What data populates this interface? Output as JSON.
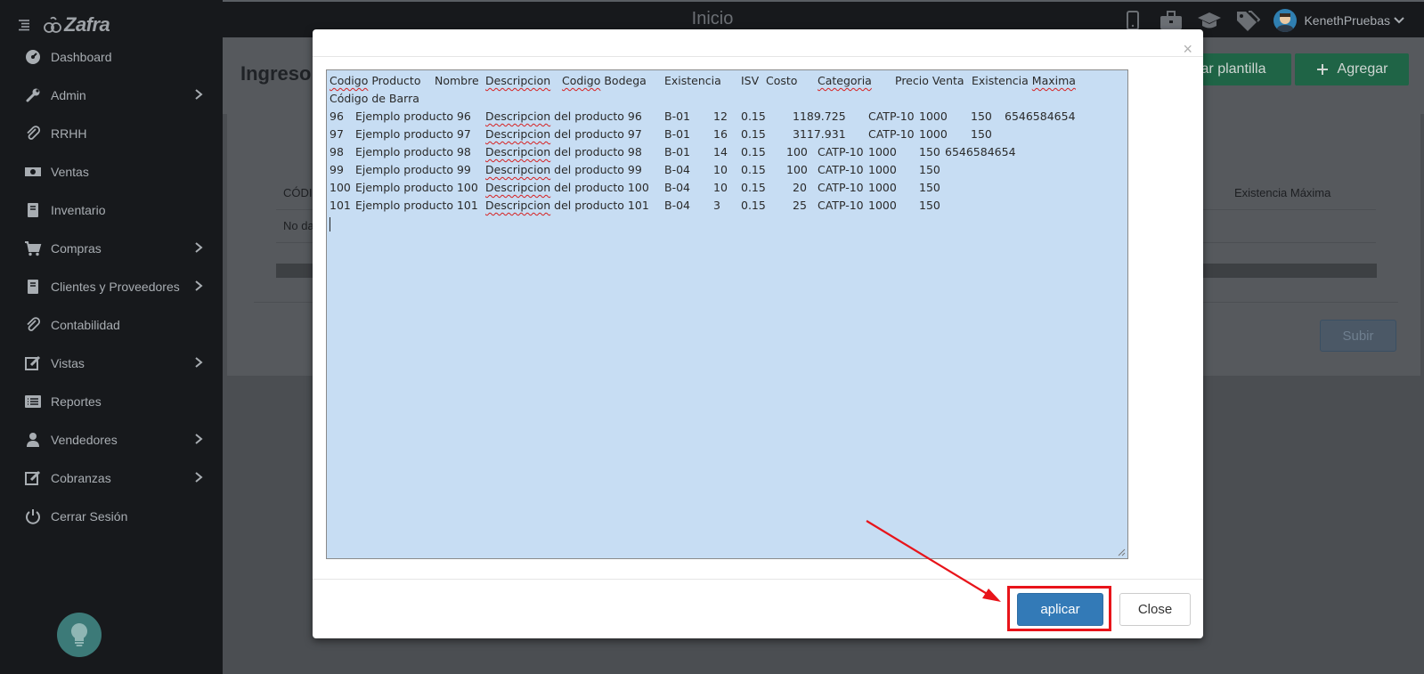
{
  "app": {
    "brand": "Zafra",
    "page_title": "Inicio"
  },
  "sidebar": {
    "items": [
      {
        "label": "Dashboard",
        "icon": "dashboard-icon",
        "submenu": false
      },
      {
        "label": "Admin",
        "icon": "wrench-icon",
        "submenu": true
      },
      {
        "label": "RRHH",
        "icon": "paperclip-icon",
        "submenu": false
      },
      {
        "label": "Ventas",
        "icon": "money-icon",
        "submenu": false
      },
      {
        "label": "Inventario",
        "icon": "book-icon",
        "submenu": false
      },
      {
        "label": "Compras",
        "icon": "cart-icon",
        "submenu": true
      },
      {
        "label": "Clientes y Proveedores",
        "icon": "book-icon",
        "submenu": true
      },
      {
        "label": "Contabilidad",
        "icon": "paperclip-icon",
        "submenu": false
      },
      {
        "label": "Vistas",
        "icon": "edit-icon",
        "submenu": true
      },
      {
        "label": "Reportes",
        "icon": "list-icon",
        "submenu": false
      },
      {
        "label": "Vendedores",
        "icon": "user-icon",
        "submenu": true
      },
      {
        "label": "Cobranzas",
        "icon": "edit-icon",
        "submenu": true
      },
      {
        "label": "Cerrar Sesión",
        "icon": "power-icon",
        "submenu": false
      }
    ]
  },
  "topbar": {
    "icons": [
      "mobile-icon",
      "briefcase-icon",
      "graduation-cap-icon",
      "tags-icon"
    ],
    "user_name": "KenethPruebas"
  },
  "background_page": {
    "title": "Ingreso",
    "buttons": {
      "template": "ar plantilla",
      "add": "Agregar",
      "upload": "Subir"
    },
    "table": {
      "header_first": "CÓDI",
      "header_last": "Existencia Máxima",
      "empty_text": "No da"
    }
  },
  "modal": {
    "close_symbol": "×",
    "textarea": {
      "header_row": [
        "Codigo Producto",
        "Nombre",
        "Descripcion",
        "Codigo Bodega",
        "Existencia",
        "ISV",
        "Costo",
        "Categoria",
        "Precio Venta",
        "Existencia Maxima"
      ],
      "header_row2": "Código de Barra",
      "rows": [
        [
          "96",
          "Ejemplo producto 96",
          "Descripcion del producto 96",
          "B-01",
          "12",
          "0.15",
          "1189.725",
          "CATP-10",
          "1000",
          "150",
          "6546584654"
        ],
        [
          "97",
          "Ejemplo producto 97",
          "Descripcion del producto 97",
          "B-01",
          "16",
          "0.15",
          "3117.931",
          "CATP-10",
          "1000",
          "150",
          ""
        ],
        [
          "98",
          "Ejemplo producto 98",
          "Descripcion del producto 98",
          "B-01",
          "14",
          "0.15",
          "100",
          "CATP-10",
          "1000",
          "150",
          "6546584654"
        ],
        [
          "99",
          "Ejemplo producto 99",
          "Descripcion del producto 99",
          "B-04",
          "10",
          "0.15",
          "100",
          "CATP-10",
          "1000",
          "150",
          ""
        ],
        [
          "100",
          "Ejemplo producto 100",
          "Descripcion del producto 100",
          "B-04",
          "10",
          "0.15",
          "20",
          "CATP-10",
          "1000",
          "150",
          ""
        ],
        [
          "101",
          "Ejemplo producto 101",
          "Descripcion del producto 101",
          "B-04",
          "3",
          "0.15",
          "25",
          "CATP-10",
          "1000",
          "150",
          ""
        ]
      ]
    },
    "buttons": {
      "apply": "aplicar",
      "close": "Close"
    }
  },
  "colors": {
    "sidebar_bg": "#17191c",
    "primary": "#337ab7",
    "success": "#1f6446",
    "annotation": "#e8141a",
    "textarea_bg": "#c7ddf3"
  }
}
